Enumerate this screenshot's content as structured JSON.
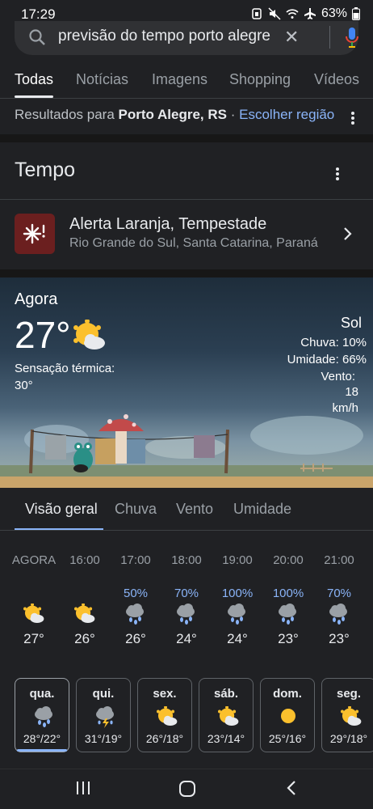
{
  "status_bar": {
    "time": "17:29",
    "battery": "63%",
    "icons": [
      "sim-icon",
      "mute-icon",
      "wifi-icon",
      "airplane-icon",
      "battery-icon"
    ]
  },
  "search": {
    "query": "previsão do tempo porto alegre"
  },
  "tabs": [
    {
      "label": "Todas",
      "active": true
    },
    {
      "label": "Notícias"
    },
    {
      "label": "Imagens"
    },
    {
      "label": "Shopping"
    },
    {
      "label": "Vídeos"
    }
  ],
  "region": {
    "prefix": "Resultados para",
    "place": "Porto Alegre, RS",
    "separator": "·",
    "link": "Escolher região"
  },
  "weather": {
    "heading": "Tempo",
    "alert": {
      "title": "Alerta Laranja, Tempestade",
      "subtitle": "Rio Grande do Sul, Santa Catarina, Paraná"
    },
    "now": {
      "label": "Agora",
      "temp": "27°",
      "feels_label": "Sensação térmica:",
      "feels_value": "30°",
      "condition": "Sol",
      "rain": "Chuva: 10%",
      "humidity": "Umidade: 66%",
      "wind_label": "Vento:",
      "wind_value": "18",
      "wind_unit": "km/h"
    },
    "subtabs": [
      {
        "label": "Visão geral",
        "active": true
      },
      {
        "label": "Chuva"
      },
      {
        "label": "Vento"
      },
      {
        "label": "Umidade"
      }
    ],
    "hourly": [
      {
        "time": "AGORA",
        "precip": "",
        "icon": "partly-sunny-icon",
        "temp": "27°"
      },
      {
        "time": "16:00",
        "precip": "",
        "icon": "partly-sunny-icon",
        "temp": "26°"
      },
      {
        "time": "17:00",
        "precip": "50%",
        "icon": "rain-cloud-icon",
        "temp": "26°"
      },
      {
        "time": "18:00",
        "precip": "70%",
        "icon": "rain-cloud-icon",
        "temp": "24°"
      },
      {
        "time": "19:00",
        "precip": "100%",
        "icon": "rain-cloud-icon",
        "temp": "24°"
      },
      {
        "time": "20:00",
        "precip": "100%",
        "icon": "rain-cloud-icon",
        "temp": "23°"
      },
      {
        "time": "21:00",
        "precip": "70%",
        "icon": "rain-cloud-icon",
        "temp": "23°"
      }
    ],
    "daily": [
      {
        "day": "qua.",
        "icon": "rain-cloud-icon",
        "temps": "28°/22°",
        "selected": true
      },
      {
        "day": "qui.",
        "icon": "thunderstorm-icon",
        "temps": "31°/19°"
      },
      {
        "day": "sex.",
        "icon": "partly-sunny-icon",
        "temps": "26°/18°"
      },
      {
        "day": "sáb.",
        "icon": "partly-sunny-icon",
        "temps": "23°/14°"
      },
      {
        "day": "dom.",
        "icon": "sun-icon",
        "temps": "25°/16°"
      },
      {
        "day": "seg.",
        "icon": "partly-sunny-icon",
        "temps": "29°/18°"
      }
    ]
  },
  "colors": {
    "background": "#202124",
    "accent_blue": "#8ab4f8",
    "alert_red": "#6b1f1f",
    "sun_yellow": "#fbc02d"
  }
}
